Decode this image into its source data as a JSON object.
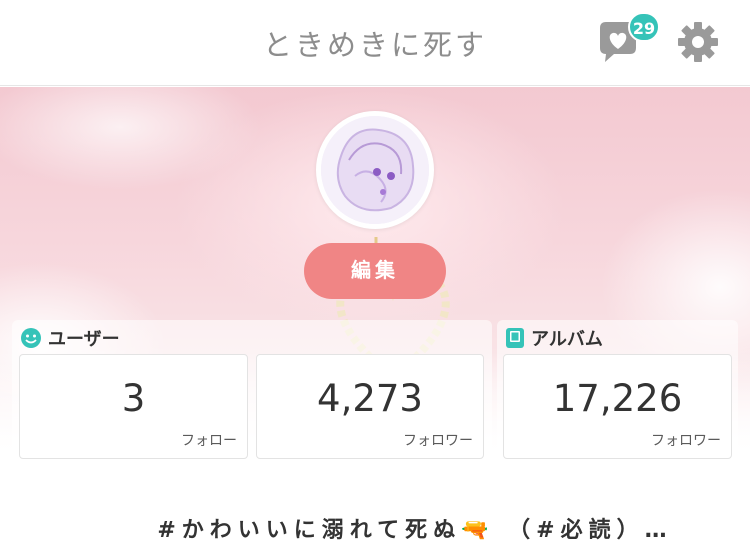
{
  "header": {
    "title": "ときめきに死す",
    "likes_badge": "29"
  },
  "profile": {
    "edit_label": "編集"
  },
  "panels": {
    "user": {
      "label": "ユーザー",
      "following": {
        "count": "3",
        "label": "フォロー"
      },
      "followers": {
        "count": "4,273",
        "label": "フォロワー"
      }
    },
    "album": {
      "label": "アルバム",
      "followers": {
        "count": "17,226",
        "label": "フォロワー"
      }
    }
  },
  "post": {
    "title": "#かわいいに溺れて死ぬ🔫 （#必読）…"
  },
  "colors": {
    "accent": "#35c3b8",
    "edit_button": "#f08585",
    "title_text": "#8d8d8d"
  },
  "icons": {
    "likes": "heart-speech-bubble-icon",
    "settings": "gear-icon",
    "user": "smiley-icon",
    "album": "album-book-icon"
  }
}
